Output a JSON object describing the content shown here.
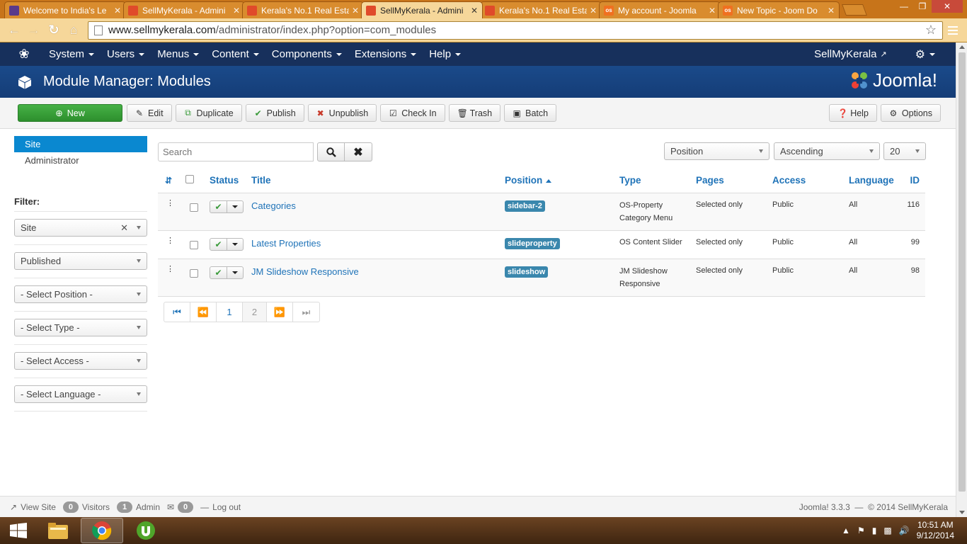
{
  "browser": {
    "tabs": [
      {
        "title": "Welcome to India's Le",
        "favicon": "joomla-favicon",
        "color": "#5a3a8a",
        "active": false
      },
      {
        "title": "SellMyKerala - Admini",
        "favicon": "joomla-favicon",
        "color": "#e04a2a",
        "active": false
      },
      {
        "title": "Kerala's No.1 Real Esta",
        "favicon": "joomla-favicon",
        "color": "#e04a2a",
        "active": false
      },
      {
        "title": "SellMyKerala - Admini",
        "favicon": "joomla-favicon",
        "color": "#e04a2a",
        "active": true
      },
      {
        "title": "Kerala's No.1 Real Esta",
        "favicon": "joomla-favicon",
        "color": "#e04a2a",
        "active": false
      },
      {
        "title": "My account - Joomla",
        "favicon": "os-favicon",
        "color": "#f07020",
        "active": false
      },
      {
        "title": "New Topic - Joom Do",
        "favicon": "os-favicon",
        "color": "#f07020",
        "active": false
      }
    ],
    "url_host": "www.sellmykerala.com",
    "url_path": "/administrator/index.php?option=com_modules"
  },
  "topnav": {
    "items": [
      "System",
      "Users",
      "Menus",
      "Content",
      "Components",
      "Extensions",
      "Help"
    ],
    "site_name": "SellMyKerala"
  },
  "header": {
    "title": "Module Manager: Modules",
    "brand": "Joomla!"
  },
  "toolbar": {
    "new": "New",
    "edit": "Edit",
    "duplicate": "Duplicate",
    "publish": "Publish",
    "unpublish": "Unpublish",
    "checkin": "Check In",
    "trash": "Trash",
    "batch": "Batch",
    "help": "Help",
    "options": "Options"
  },
  "sidebar": {
    "items": [
      "Site",
      "Administrator"
    ],
    "filter_label": "Filter:",
    "filters": [
      "Site",
      "Published",
      "- Select Position -",
      "- Select Type -",
      "- Select Access -",
      "- Select Language -"
    ]
  },
  "search": {
    "placeholder": "Search"
  },
  "sorting": {
    "field": "Position",
    "direction": "Ascending",
    "limit": "20"
  },
  "table": {
    "headers": {
      "status": "Status",
      "title": "Title",
      "position": "Position",
      "type": "Type",
      "pages": "Pages",
      "access": "Access",
      "language": "Language",
      "id": "ID"
    },
    "rows": [
      {
        "title": "Categories",
        "position": "sidebar-2",
        "type_line1": "OS-Property",
        "type_line2": "Category Menu",
        "pages": "Selected only",
        "access": "Public",
        "language": "All",
        "id": "116"
      },
      {
        "title": "Latest Properties",
        "position": "slideproperty",
        "type_line1": "OS Content Slider",
        "type_line2": "",
        "pages": "Selected only",
        "access": "Public",
        "language": "All",
        "id": "99"
      },
      {
        "title": "JM Slideshow Responsive",
        "position": "slideshow",
        "type_line1": "JM Slideshow",
        "type_line2": "Responsive",
        "pages": "Selected only",
        "access": "Public",
        "language": "All",
        "id": "98"
      }
    ]
  },
  "pagination": {
    "pages": [
      "1",
      "2"
    ],
    "current": "2"
  },
  "statusbar": {
    "view_site": "View Site",
    "visitors_count": "0",
    "visitors_label": "Visitors",
    "admin_count": "1",
    "admin_label": "Admin",
    "messages_count": "0",
    "logout": "Log out",
    "version": "Joomla! 3.3.3",
    "copyright": "© 2014 SellMyKerala"
  },
  "taskbar": {
    "time": "10:51 AM",
    "date": "9/12/2014"
  }
}
